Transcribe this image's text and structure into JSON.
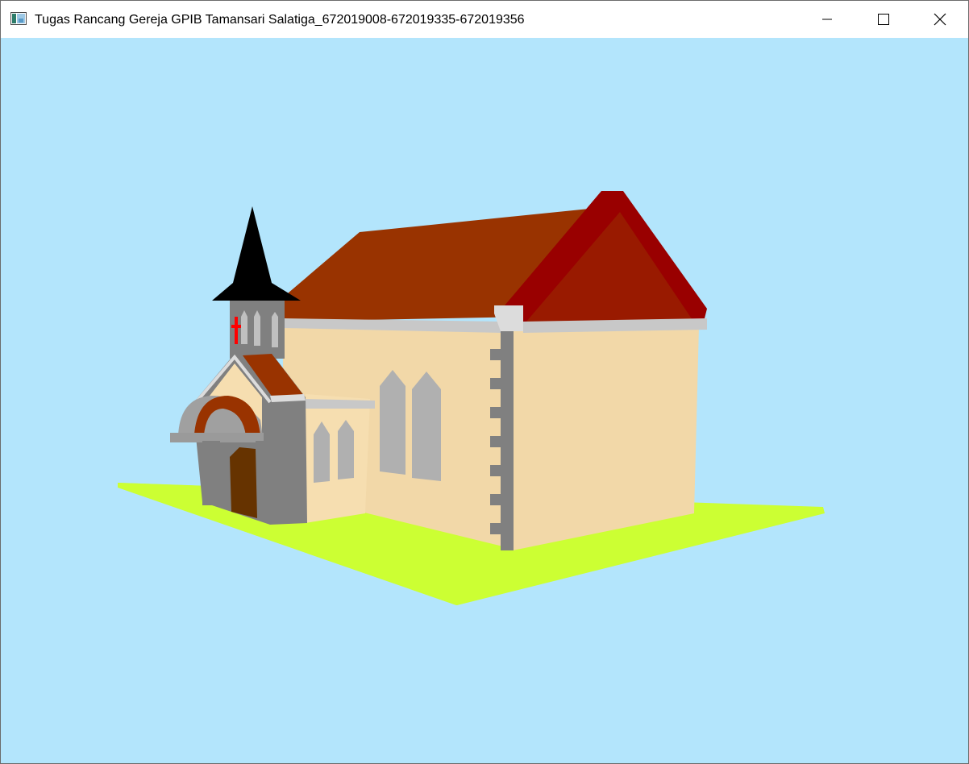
{
  "window": {
    "title": "Tugas Rancang Gereja GPIB Tamansari Salatiga_672019008-672019335-672019356",
    "app_icon": "opengl-window-icon",
    "controls": {
      "minimize_icon": "minimize-icon",
      "maximize_icon": "maximize-icon",
      "close_icon": "close-icon"
    }
  },
  "scene": {
    "subject": "3d-church-model",
    "colors": {
      "sky": "#b3e5fc",
      "ground": "#ccff33",
      "wall": "#f2d8a8",
      "roof": "#993300",
      "gable": "#990000",
      "stone": "#808080",
      "window_glass": "#b0b0b0",
      "door": "#663300",
      "spire": "#000000",
      "cross": "#ff0000"
    }
  }
}
